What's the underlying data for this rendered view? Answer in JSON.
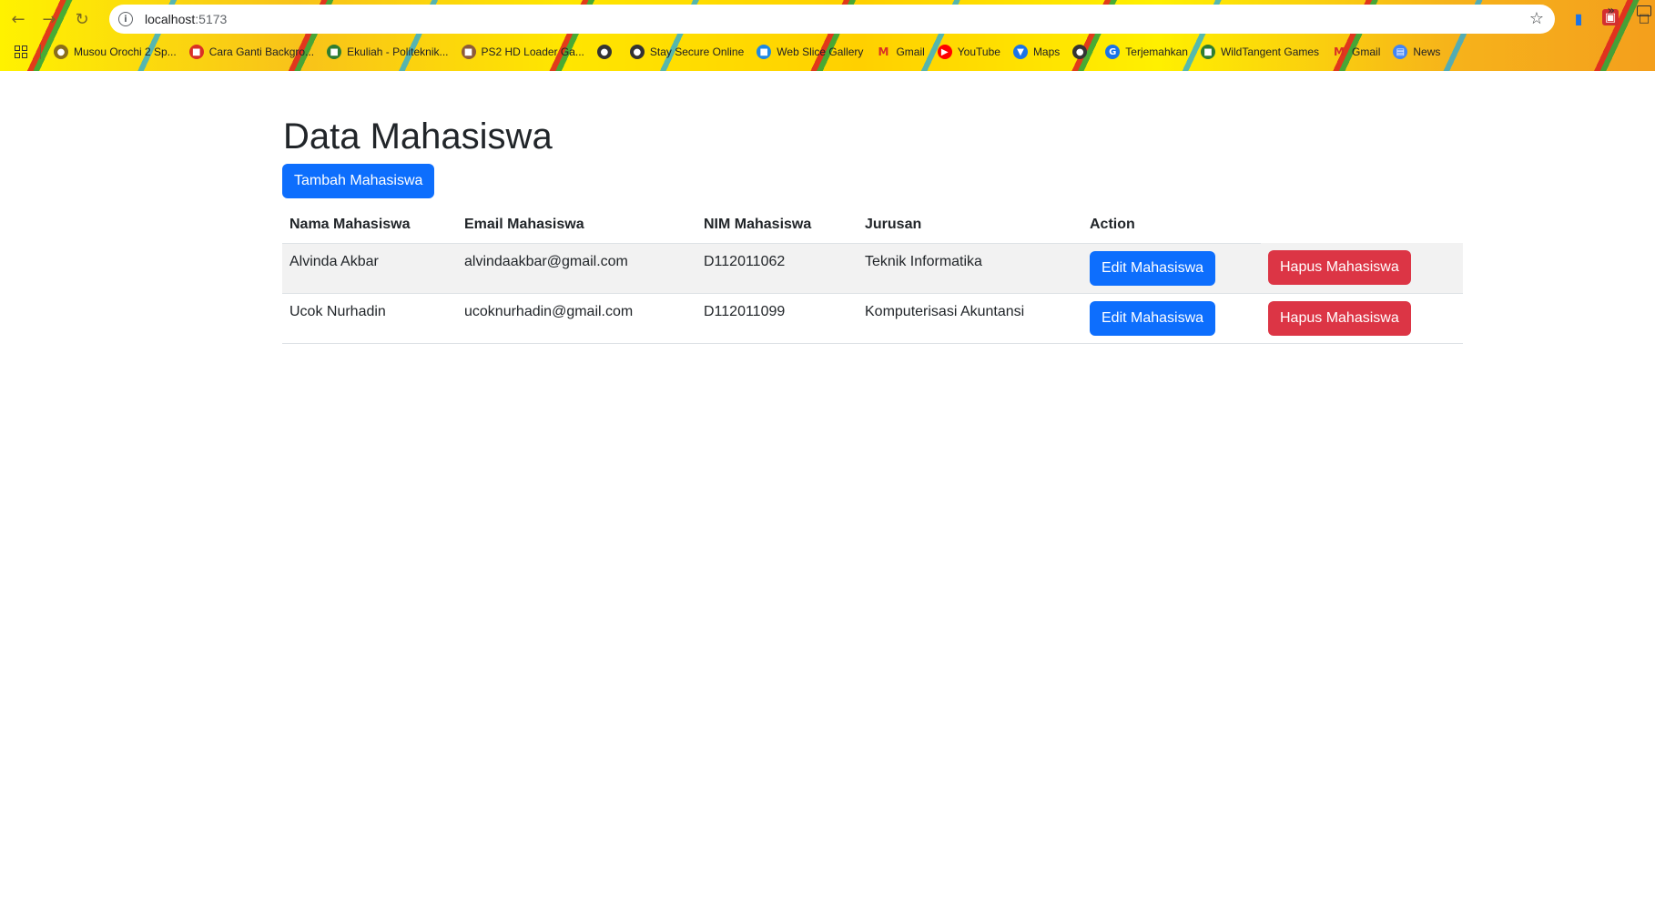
{
  "browser": {
    "url_host": "localhost",
    "url_port": ":5173",
    "bookmarks": [
      {
        "label": "Musou Orochi 2 Sp...",
        "icon": "globe-icon",
        "color": "#8a6d1a"
      },
      {
        "label": "Cara Ganti Backgro...",
        "icon": "site-icon",
        "color": "#d93025"
      },
      {
        "label": "Ekuliah - Politeknik...",
        "icon": "site-icon",
        "color": "#2e7d32"
      },
      {
        "label": "PS2 HD Loader Ga...",
        "icon": "site-icon",
        "color": "#8d5b3a"
      },
      {
        "label": "",
        "icon": "globe-icon",
        "color": "#333333"
      },
      {
        "label": "Stay Secure Online",
        "icon": "globe-icon",
        "color": "#333333"
      },
      {
        "label": "Web Slice Gallery",
        "icon": "site-icon",
        "color": "#1e88e5"
      },
      {
        "label": "Gmail",
        "icon": "gmail-icon",
        "color": "#d93025"
      },
      {
        "label": "YouTube",
        "icon": "youtube-icon",
        "color": "#ff0000"
      },
      {
        "label": "Maps",
        "icon": "maps-icon",
        "color": "#1a73e8"
      },
      {
        "label": "",
        "icon": "globe-icon",
        "color": "#333333"
      },
      {
        "label": "Terjemahkan",
        "icon": "translate-icon",
        "color": "#1a73e8"
      },
      {
        "label": "WildTangent Games",
        "icon": "site-icon",
        "color": "#2e7d32"
      },
      {
        "label": "Gmail",
        "icon": "gmail-icon",
        "color": "#d93025"
      },
      {
        "label": "News",
        "icon": "news-icon",
        "color": "#4285f4"
      }
    ]
  },
  "page": {
    "title": "Data Mahasiswa",
    "add_button": "Tambah Mahasiswa",
    "table": {
      "headers": [
        "Nama Mahasiswa",
        "Email Mahasiswa",
        "NIM Mahasiswa",
        "Jurusan",
        "Action"
      ],
      "rows": [
        {
          "nama": "Alvinda Akbar",
          "email": "alvindaakbar@gmail.com",
          "nim": "D112011062",
          "jurusan": "Teknik Informatika",
          "edit_label": "Edit Mahasiswa",
          "delete_label": "Hapus Mahasiswa"
        },
        {
          "nama": "Ucok Nurhadin",
          "email": "ucoknurhadin@gmail.com",
          "nim": "D112011099",
          "jurusan": "Komputerisasi Akuntansi",
          "edit_label": "Edit Mahasiswa",
          "delete_label": "Hapus Mahasiswa"
        }
      ]
    }
  },
  "colors": {
    "primary": "#0d6efd",
    "danger": "#dc3545",
    "stripe": "#f2f2f2"
  }
}
